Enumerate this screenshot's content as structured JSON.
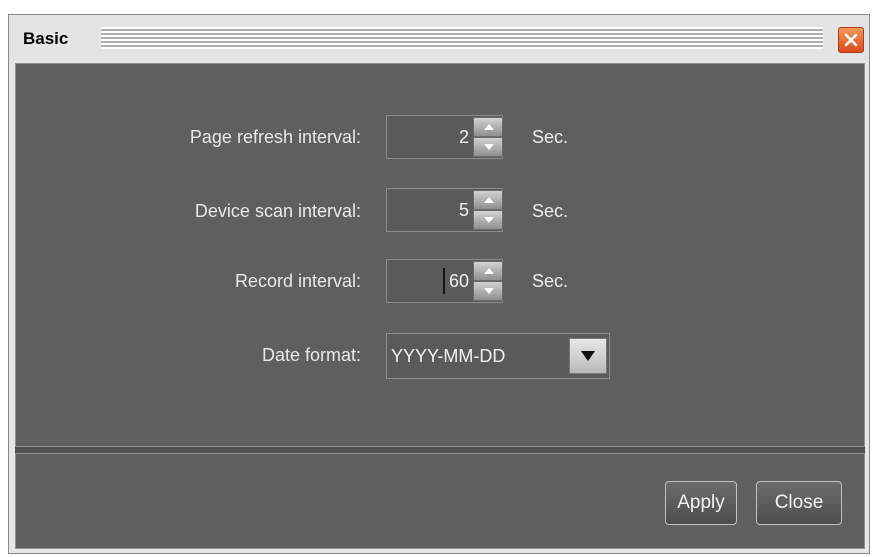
{
  "dialog": {
    "title": "Basic",
    "close_icon": "close-icon"
  },
  "fields": {
    "page_refresh": {
      "label": "Page refresh interval:",
      "value": "2",
      "unit": "Sec."
    },
    "device_scan": {
      "label": "Device scan interval:",
      "value": "5",
      "unit": "Sec."
    },
    "record": {
      "label": "Record interval:",
      "value": "60",
      "unit": "Sec."
    },
    "date_format": {
      "label": "Date format:",
      "value": "YYYY-MM-DD"
    }
  },
  "buttons": {
    "apply": "Apply",
    "close": "Close"
  },
  "colors": {
    "panel_bg": "#5f5f5f",
    "close_accent": "#e26a2c"
  }
}
